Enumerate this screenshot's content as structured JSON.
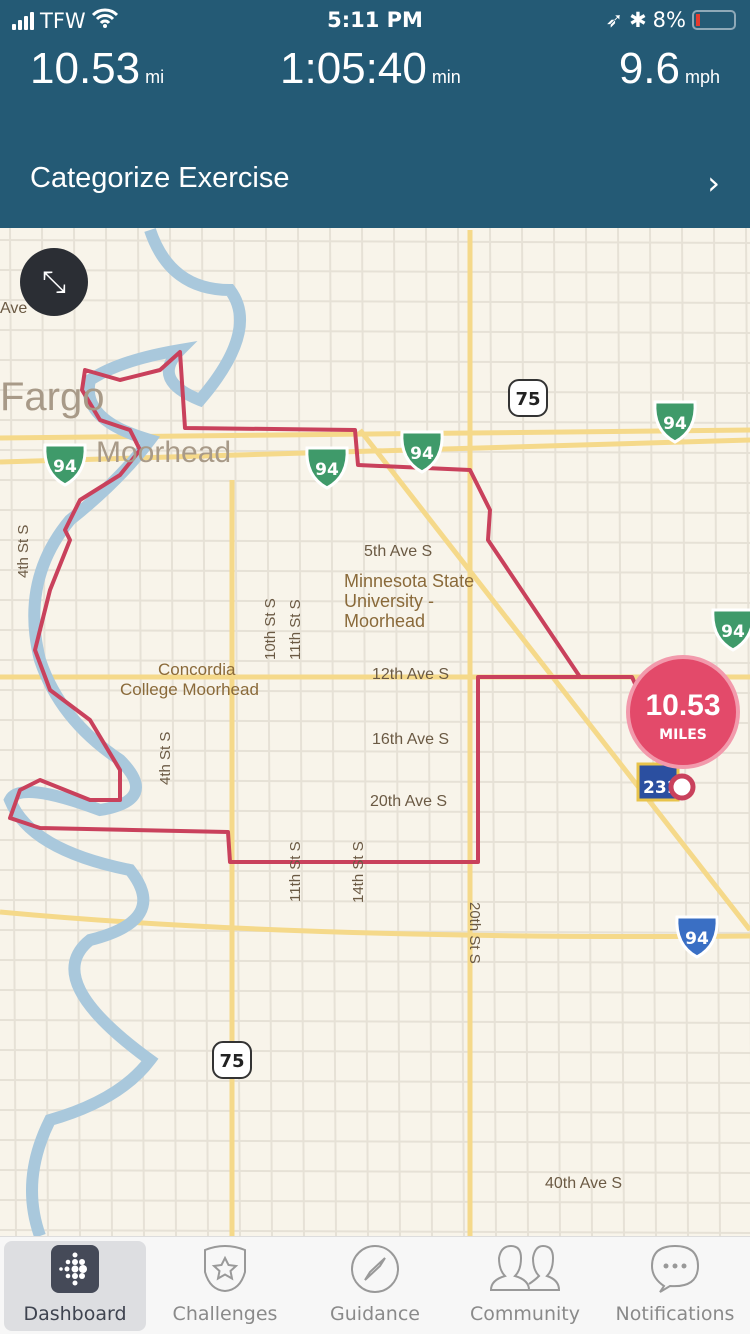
{
  "status_bar": {
    "carrier": "TFW",
    "time": "5:11 PM",
    "battery": "8%",
    "battery_level": 0.08
  },
  "stats": [
    {
      "value": "10.53",
      "unit": "mi"
    },
    {
      "value": "1:05:40",
      "unit": "min"
    },
    {
      "value": "9.6",
      "unit": "mph"
    }
  ],
  "categorize": {
    "label": "Categorize Exercise"
  },
  "map": {
    "labels": [
      "Fargo",
      "Moorhead",
      "5th Ave S",
      "Minnesota State",
      "University -",
      "Moorhead",
      "Concordia",
      "College Moorhead",
      "12th Ave S",
      "16th Ave S",
      "20th Ave S",
      "40th Ave S",
      "4th St S",
      "10th St S",
      "11th St S",
      "4th St S",
      "11th St S",
      "14th St S",
      "20th St S",
      "Ave"
    ],
    "shields": {
      "interstate": "94",
      "us": "75",
      "state": "231"
    },
    "route_color": "#c9415c",
    "river_color": "#a9c8dc"
  },
  "distance_badge": {
    "value": "10.53",
    "unit": "MILES"
  },
  "tabs": [
    {
      "label": "Dashboard",
      "icon": "fitbit-logo-icon",
      "active": true
    },
    {
      "label": "Challenges",
      "icon": "star-shield-icon"
    },
    {
      "label": "Guidance",
      "icon": "compass-icon"
    },
    {
      "label": "Community",
      "icon": "people-icon"
    },
    {
      "label": "Notifications",
      "icon": "chat-bubble-icon"
    }
  ]
}
